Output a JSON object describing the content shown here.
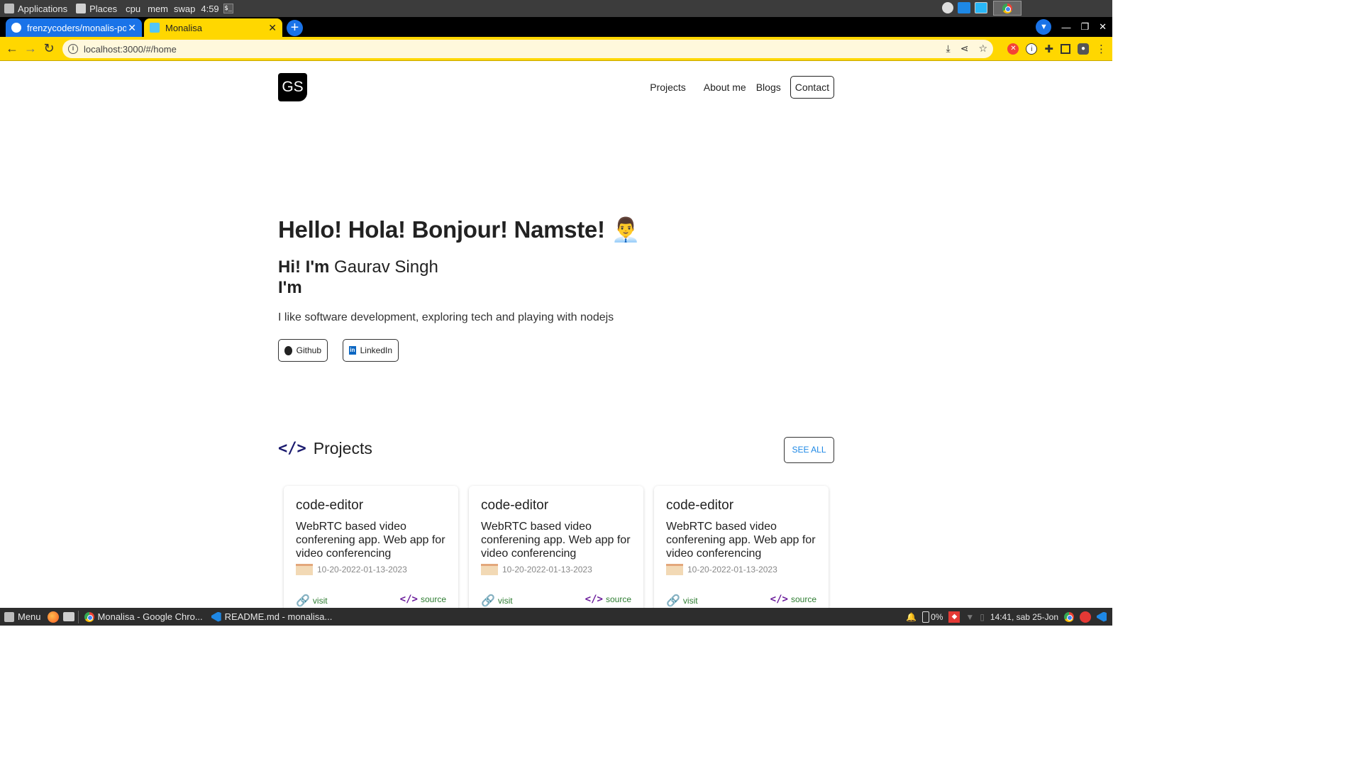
{
  "os_top": {
    "applications": "Applications",
    "places": "Places",
    "cpu": "cpu",
    "mem": "mem",
    "swap": "swap",
    "time_short": "4:59",
    "terminal_glyph": "$_"
  },
  "browser": {
    "tabs": [
      {
        "label": "frenzycoders/monalis-por",
        "active": false
      },
      {
        "label": "Monalisa",
        "active": true
      }
    ],
    "new_tab": "+",
    "url": "localhost:3000/#/home",
    "accent": "#ffd700"
  },
  "site": {
    "logo": "GS",
    "nav": {
      "projects": "Projects",
      "about": "About me",
      "blogs": "Blogs",
      "contact": "Contact"
    },
    "hero": {
      "greeting": "Hello! Hola! Bonjour! Namste! 👨‍💼",
      "hi": "Hi! I'm",
      "name": "Gaurav Singh",
      "im": "I'm",
      "description": "I like software development, exploring tech and playing with nodejs",
      "github": "Github",
      "linkedin": "LinkedIn"
    },
    "projects": {
      "title": "Projects",
      "see_all": "SEE ALL",
      "cards": [
        {
          "title": "code-editor",
          "description": "WebRTC based video conferening app. Web app for video conferencing",
          "dates": "10-20-2022-01-13-2023",
          "visit": "visit",
          "source": "source"
        },
        {
          "title": "code-editor",
          "description": "WebRTC based video conferening app. Web app for video conferencing",
          "dates": "10-20-2022-01-13-2023",
          "visit": "visit",
          "source": "source"
        },
        {
          "title": "code-editor",
          "description": "WebRTC based video conferening app. Web app for video conferencing",
          "dates": "10-20-2022-01-13-2023",
          "visit": "visit",
          "source": "source"
        }
      ]
    }
  },
  "os_bottom": {
    "menu": "Menu",
    "tasks": [
      {
        "label": "Monalisa - Google Chro..."
      },
      {
        "label": "README.md - monalisa..."
      }
    ],
    "battery": "0%",
    "clock": "14:41, sab 25-Jon"
  }
}
